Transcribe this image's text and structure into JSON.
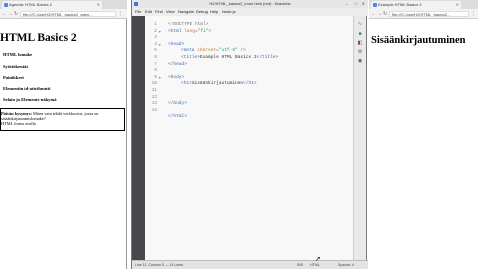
{
  "left_browser": {
    "tab_title": "Agenda: HTML Basics 2",
    "url": "file:///C:/ose/H2/HTML_basics2_agen...",
    "heading": "HTML Basics 2",
    "items": [
      "HTML lomake",
      "Syöttökentät",
      "Painikkeet",
      "Elementin id-attribuutti",
      "Selain ja Elements-näkymä"
    ],
    "question_label": "Päivän kysymys:",
    "question_text": " Miten vain tehdä verkkosivu, jossa on ",
    "question_text2": "sisäänkirjautumislomake?",
    "question_text3": "HTML forms avulla"
  },
  "editor": {
    "title": "H2/HTML_basics2_inom.html (red) - Brackets",
    "menu": [
      "File",
      "Edit",
      "Find",
      "View",
      "Navigate",
      "Debug",
      "Help",
      "Node.js"
    ],
    "lines": [
      "1",
      "2",
      "3",
      "4",
      "5",
      "6",
      "7",
      "8",
      "9",
      "10",
      "11",
      "12",
      "13",
      "14"
    ],
    "code": {
      "l1": "<!DOCTYPE html>",
      "l2a": "<html ",
      "l2b": "lang",
      "l2c": "=",
      "l2d": "\"fi\"",
      "l2e": ">",
      "l4": "<head>",
      "l5a": "<meta ",
      "l5b": "charset",
      "l5c": "=",
      "l5d": "\"utf-8\"",
      "l5e": " />",
      "l6a": "<title>",
      "l6b": "Example HTML Basics 2",
      "l6c": "</title>",
      "l7": "</head>",
      "l9": "<body>",
      "l10a": "<h1>",
      "l10b": "Sisäänkirjautuminen",
      "l10c": "</h1>",
      "l12": "</body>",
      "l14": "</html>"
    },
    "status_left": "Line 11, Column 5 — 14 Lines",
    "status_ins": "INS",
    "status_mode": "HTML",
    "status_spaces": "Spaces: 4"
  },
  "right_browser": {
    "tab_title": "Example HTML Basics 2",
    "url": "file:///C:/ose/H2/HTML_basics2...",
    "heading": "Sisäänkirjautuminen"
  }
}
